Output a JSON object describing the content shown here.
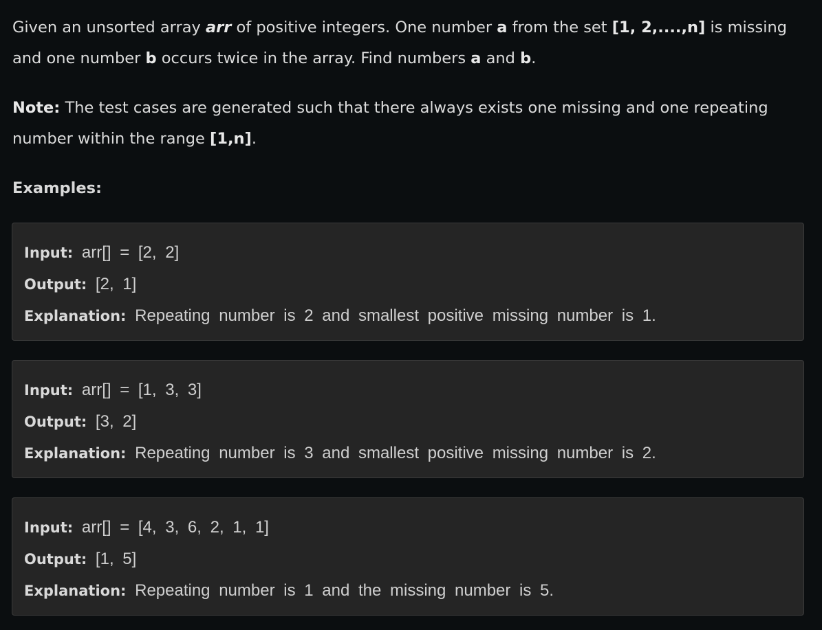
{
  "intro": {
    "t1": "Given an unsorted array ",
    "arr": "arr",
    "t2": " of positive integers. One number ",
    "a": "a",
    "t3": " from the set ",
    "set": "[1, 2,....,n]",
    "t4": " is missing and one number ",
    "b": "b",
    "t5": " occurs twice in the array. Find numbers ",
    "a2": "a",
    "t6": " and ",
    "b2": "b",
    "t7": "."
  },
  "note": {
    "label": "Note:",
    "t1": " The test cases are generated such that there always exists one missing and one repeating number within the range ",
    "range": "[1,n]",
    "t2": "."
  },
  "examples_heading": "Examples:",
  "examples": [
    {
      "input_label": "Input:",
      "input": " arr[] = [2, 2]",
      "output_label": "Output:",
      "output": " [2, 1]",
      "explanation_label": "Explanation:",
      "explanation": " Repeating number is 2 and smallest positive missing number is 1."
    },
    {
      "input_label": "Input:",
      "input": " arr[] = [1, 3, 3]",
      "output_label": "Output:",
      "output": " [3, 2]",
      "explanation_label": "Explanation:",
      "explanation": " Repeating number is 3 and smallest positive missing number is 2."
    },
    {
      "input_label": "Input:",
      "input": " arr[] = [4, 3, 6, 2, 1, 1]",
      "output_label": "Output:",
      "output": " [1, 5]",
      "explanation_label": "Explanation:",
      "explanation": " Repeating number is 1 and the missing number is 5."
    }
  ]
}
